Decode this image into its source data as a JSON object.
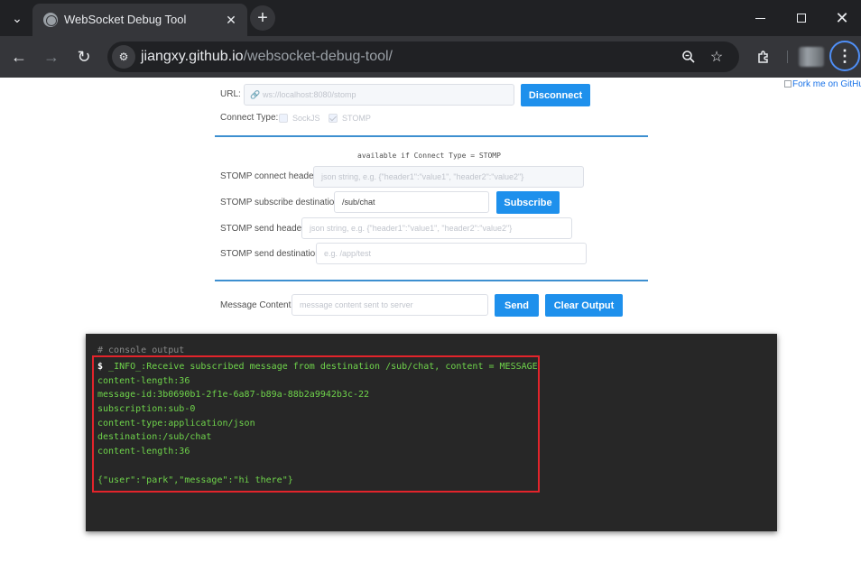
{
  "browser": {
    "tab_title": "WebSocket Debug Tool",
    "url_host": "jiangxy.github.io",
    "url_path": "/websocket-debug-tool/"
  },
  "page": {
    "fork_text": "Fork me on GitHub",
    "url_label": "URL:",
    "url_value": "ws://localhost:8080/stomp",
    "disconnect_label": "Disconnect",
    "connect_type_label": "Connect Type:",
    "sockjs_label": "SockJS",
    "sockjs_checked": false,
    "stomp_label": "STOMP",
    "stomp_checked": true,
    "hint": "available if Connect Type = STOMP",
    "connect_header_label": "STOMP connect header:",
    "connect_header_placeholder": "json string, e.g. {\"header1\":\"value1\", \"header2\":\"value2\"}",
    "subscribe_dest_label": "STOMP subscribe destination:",
    "subscribe_dest_value": "/sub/chat",
    "subscribe_label": "Subscribe",
    "send_header_label": "STOMP send header:",
    "send_header_placeholder": "json string, e.g. {\"header1\":\"value1\", \"header2\":\"value2\"}",
    "send_dest_label": "STOMP send destination:",
    "send_dest_placeholder": "e.g. /app/test",
    "message_label": "Message Content:",
    "message_placeholder": "message content sent to server",
    "send_label": "Send",
    "clear_label": "Clear Output"
  },
  "console": {
    "title": "# console output",
    "prompt": "$",
    "lines": [
      " _INFO_:Receive subscribed message from destination /sub/chat, content = MESSAGE",
      "content-length:36",
      "message-id:3b0690b1-2f1e-6a87-b89a-88b2a9942b3c-22",
      "subscription:sub-0",
      "content-type:application/json",
      "destination:/sub/chat",
      "content-length:36",
      "",
      "{\"user\":\"park\",\"message\":\"hi there\"}"
    ]
  },
  "colors": {
    "accent": "#1e90ec",
    "console_text": "#6fd44b",
    "highlight": "#e3242b"
  }
}
